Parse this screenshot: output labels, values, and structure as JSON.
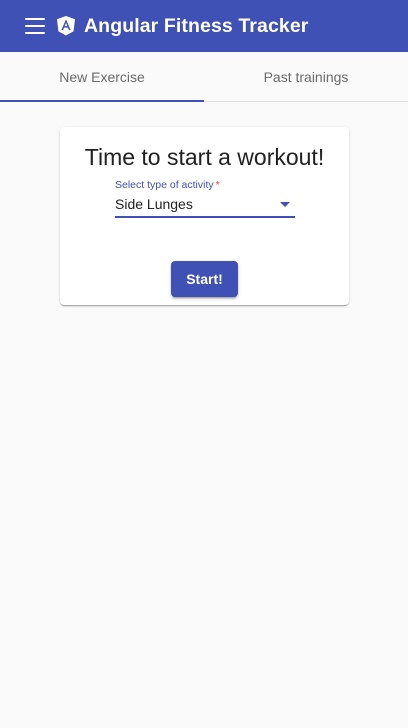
{
  "toolbar": {
    "menu_icon": "menu-icon",
    "logo_icon": "angular-logo-icon",
    "title": "Angular Fitness Tracker",
    "background_color": "#3f51b5"
  },
  "tabs": [
    {
      "label": "New Exercise",
      "active": true
    },
    {
      "label": "Past trainings",
      "active": false
    }
  ],
  "card": {
    "title": "Time to start a workout!",
    "select": {
      "label": "Select type of activity",
      "required_marker": "*",
      "value": "Side Lunges"
    },
    "start_label": "Start!"
  },
  "accent_color": "#3f51b5"
}
